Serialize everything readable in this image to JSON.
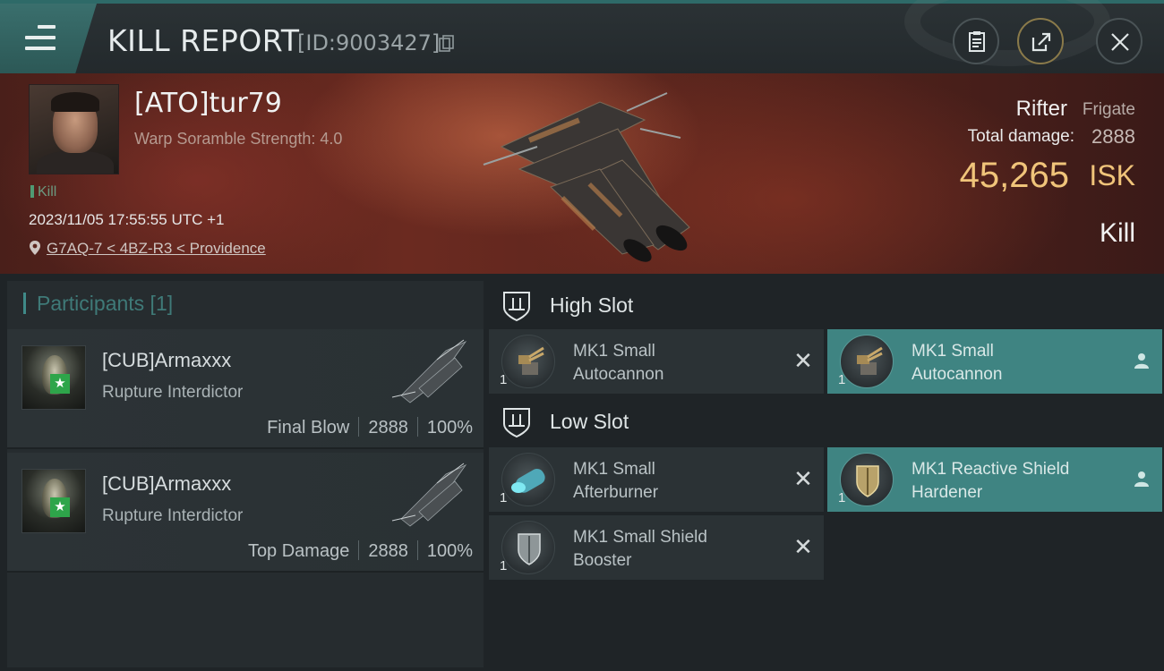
{
  "header": {
    "title": "KILL REPORT",
    "report_id": "[ID:9003427]"
  },
  "victim": {
    "name": "[ATO]tur79",
    "warp": "Warp Soramble Strength: 4.0",
    "tag": "Kill",
    "timestamp": "2023/11/05 17:55:55 UTC +1",
    "location": "G7AQ-7 < 4BZ-R3 < Providence",
    "ship_name": "Rifter",
    "ship_class": "Frigate",
    "damage_label": "Total damage:",
    "damage_value": "2888",
    "isk_value": "45,265",
    "isk_unit": "ISK",
    "result": "Kill"
  },
  "participants": {
    "title": "Participants [1]",
    "items": [
      {
        "name": "[CUB]Armaxxx",
        "ship": "Rupture Interdictor",
        "role": "Final Blow",
        "damage": "2888",
        "percent": "100%"
      },
      {
        "name": "[CUB]Armaxxx",
        "ship": "Rupture Interdictor",
        "role": "Top Damage",
        "damage": "2888",
        "percent": "100%"
      }
    ]
  },
  "slots": {
    "high": {
      "label": "High Slot",
      "items": [
        {
          "name_line1": "MK1 Small",
          "name_line2": "Autocannon",
          "qty": "1",
          "status": "destroyed"
        },
        {
          "name_line1": "MK1 Small",
          "name_line2": "Autocannon",
          "qty": "1",
          "status": "dropped"
        }
      ]
    },
    "low": {
      "label": "Low Slot",
      "items": [
        {
          "name_line1": "MK1 Small",
          "name_line2": "Afterburner",
          "qty": "1",
          "status": "destroyed"
        },
        {
          "name_line1": "MK1 Reactive Shield",
          "name_line2": "Hardener",
          "qty": "1",
          "status": "dropped"
        },
        {
          "name_line1": "MK1 Small Shield",
          "name_line2": "Booster",
          "qty": "1",
          "status": "destroyed"
        }
      ]
    }
  },
  "icons": {
    "menu": "menu-icon",
    "copy": "copy-icon",
    "clipboard": "clipboard-icon",
    "share": "share-icon",
    "close": "close-icon",
    "location": "location-pin-icon",
    "slot": "slot-shield-icon",
    "destroyed": "x-icon",
    "dropped": "person-icon"
  },
  "colors": {
    "accent": "#3f8482",
    "isk": "#f0c47a",
    "kill_tag": "#4f9a73",
    "background": "#1f2427"
  }
}
